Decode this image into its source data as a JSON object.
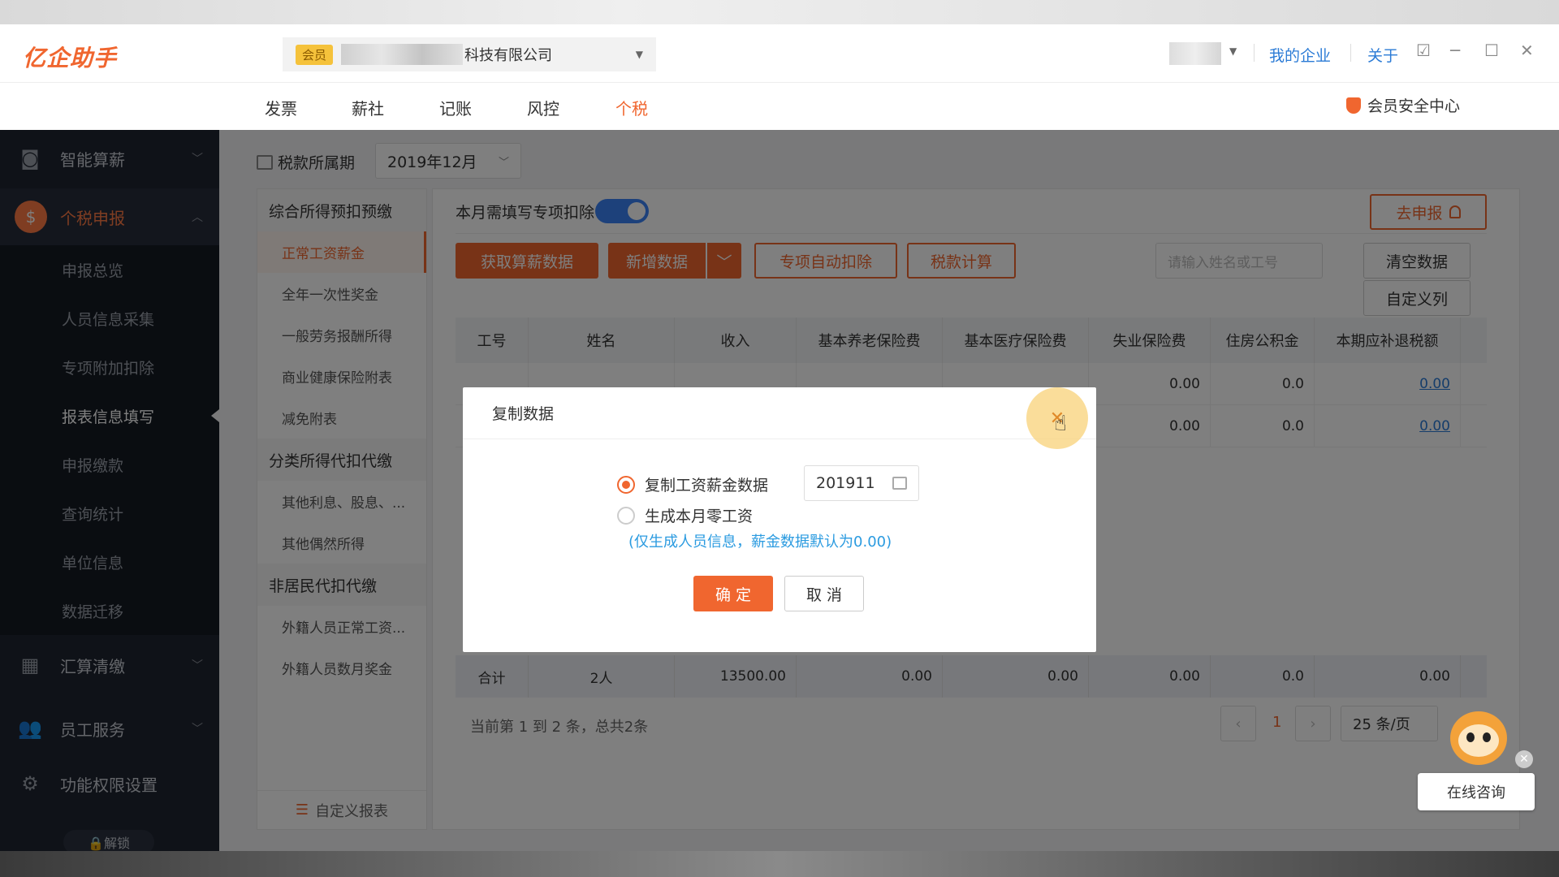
{
  "app": {
    "logo": "亿企助手",
    "member_badge": "会员",
    "company_suffix": "科技有限公司",
    "links": {
      "my_company": "我的企业",
      "about": "关于"
    },
    "security_center": "会员安全中心"
  },
  "main_menu": [
    {
      "label": "发票"
    },
    {
      "label": "薪社"
    },
    {
      "label": "记账"
    },
    {
      "label": "风控"
    },
    {
      "label": "个税",
      "active": true
    }
  ],
  "sidebar": {
    "groups": [
      {
        "label": "智能算薪"
      },
      {
        "label": "个税申报",
        "active": true
      },
      {
        "label": "汇算清缴"
      },
      {
        "label": "员工服务"
      },
      {
        "label": "功能权限设置"
      }
    ],
    "tax_items": [
      {
        "label": "申报总览"
      },
      {
        "label": "人员信息采集"
      },
      {
        "label": "专项附加扣除"
      },
      {
        "label": "报表信息填写",
        "selected": true
      },
      {
        "label": "申报缴款"
      },
      {
        "label": "查询统计"
      },
      {
        "label": "单位信息"
      },
      {
        "label": "数据迁移"
      }
    ],
    "unlock": "🔒解锁"
  },
  "content": {
    "period_label": "税款所属期",
    "period_value": "2019年12月",
    "left_panel": {
      "sections": [
        {
          "title": "综合所得预扣预缴",
          "items": [
            "正常工资薪金",
            "全年一次性奖金",
            "一般劳务报酬所得",
            "商业健康保险附表",
            "减免附表"
          ]
        },
        {
          "title": "分类所得代扣代缴",
          "items": [
            "其他利息、股息、...",
            "其他偶然所得"
          ]
        },
        {
          "title": "非居民代扣代缴",
          "items": [
            "外籍人员正常工资...",
            "外籍人员数月奖金"
          ]
        }
      ],
      "footer": "自定义报表"
    },
    "toggle_label": "本月需填写专项扣除",
    "declare_button": "去申报",
    "buttons": {
      "fetch": "获取算薪数据",
      "add": "新增数据",
      "auto_deduct": "专项自动扣除",
      "tax_calc": "税款计算",
      "clear": "清空数据",
      "custom_cols": "自定义列"
    },
    "search_placeholder": "请输入姓名或工号",
    "table": {
      "headers": [
        "工号",
        "姓名",
        "收入",
        "基本养老保险费",
        "基本医疗保险费",
        "失业保险费",
        "住房公积金",
        "本期应补退税额"
      ],
      "rows": [
        [
          "",
          "",
          "",
          "",
          "",
          "0.00",
          "0.0",
          "0.00"
        ],
        [
          "",
          "",
          "",
          "",
          "",
          "0.00",
          "0.0",
          "0.00"
        ]
      ],
      "footer": [
        "合计",
        "2人",
        "13500.00",
        "0.00",
        "0.00",
        "0.00",
        "0.0",
        "0.00"
      ]
    },
    "pagination": {
      "info": "当前第 1 到 2 条，总共2条",
      "page": "1",
      "page_size": "25 条/页"
    }
  },
  "dialog": {
    "title": "复制数据",
    "option1": "复制工资薪金数据",
    "option1_month": "201911",
    "option2": "生成本月零工资",
    "note": "(仅生成人员信息，薪金数据默认为0.00)",
    "ok": "确 定",
    "cancel": "取 消"
  },
  "consult": {
    "label": "在线咨询"
  },
  "colors": {
    "accent": "#f0662f",
    "link": "#2b7bd6",
    "toggle": "#3b82f6",
    "sidebar": "#1e2430"
  }
}
